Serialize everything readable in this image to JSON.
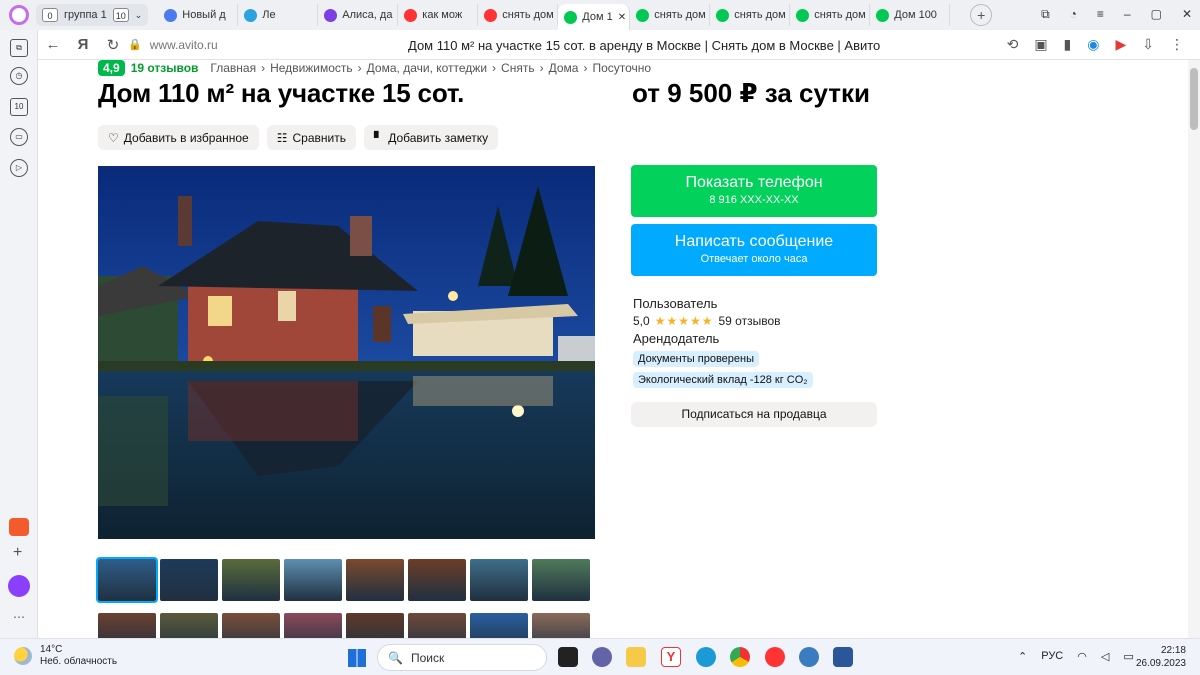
{
  "browser": {
    "group_label": "группа 1",
    "group_count": "10",
    "tabs": [
      {
        "label": "Новый д",
        "color": "#4a7cf0"
      },
      {
        "label": "Ле",
        "color": "#2aa3e0"
      },
      {
        "label": "Алиса, да",
        "color": "#7b3fe4"
      },
      {
        "label": "как мож",
        "color": "#f33"
      },
      {
        "label": "снять дом",
        "color": "#f33"
      },
      {
        "label": "Дом 1",
        "color": "#00c853",
        "active": true
      },
      {
        "label": "снять дом",
        "color": "#00c853"
      },
      {
        "label": "снять дом",
        "color": "#00c853"
      },
      {
        "label": "снять дом",
        "color": "#00c853"
      },
      {
        "label": "Дом 100",
        "color": "#00c853"
      }
    ],
    "close_glyph": "✕",
    "new_tab_glyph": "+",
    "url": "www.avito.ru",
    "page_title": "Дом 110 м² на участке 15 сот. в аренду в Москве | Снять дом в Москве | Авито"
  },
  "listing": {
    "rating": "4,9",
    "reviews": "19 отзывов",
    "breadcrumbs": [
      "Главная",
      "Недвижимость",
      "Дома, дачи, коттеджи",
      "Снять",
      "Дома",
      "Посуточно"
    ],
    "title": "Дом 110 м² на участке 15 сот.",
    "price": "от 9 500 ₽ за сутки",
    "actions": {
      "favorite": "Добавить в избранное",
      "compare": "Сравнить",
      "note": "Добавить заметку"
    },
    "phone_button": {
      "label": "Показать телефон",
      "sub": "8 916 XXX-XX-XX"
    },
    "message_button": {
      "label": "Написать сообщение",
      "sub": "Отвечает около часа"
    },
    "seller": {
      "name": "Пользователь",
      "score": "5,0",
      "stars": "★★★★★",
      "reviews": "59 отзывов",
      "role": "Арендодатель",
      "tags": [
        "Документы проверены",
        "Экологический вклад -128 кг CO₂"
      ]
    },
    "subscribe": "Подписаться на продавца"
  },
  "taskbar": {
    "temp": "14°C",
    "weather": "Неб. облачность",
    "search": "Поиск",
    "lang": "РУС",
    "time": "22:18",
    "date": "26.09.2023"
  }
}
